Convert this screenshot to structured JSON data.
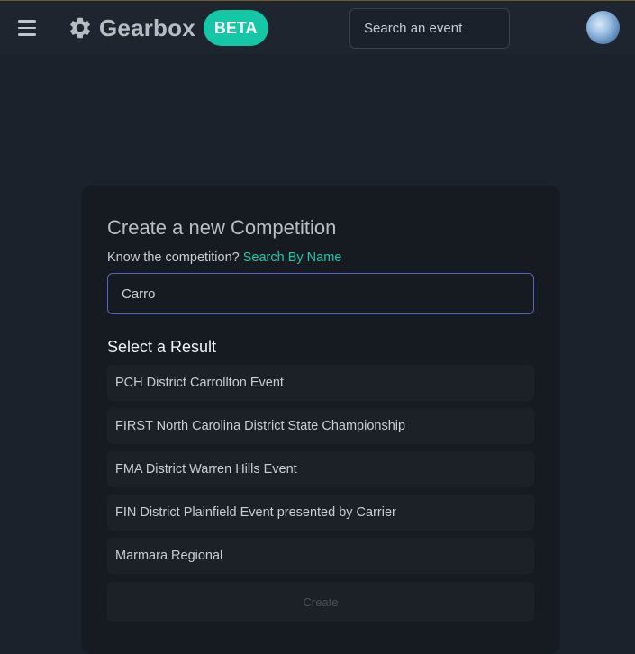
{
  "header": {
    "brand_name": "Gearbox",
    "badge": "BETA",
    "search_placeholder": "Search an event",
    "menu_icon": "hamburger-menu-icon",
    "logo_icon": "gear-icon"
  },
  "colors": {
    "accent": "#14c7a7",
    "link": "#1fc8a9",
    "input_focus_border": "#5a5fc4",
    "background": "#1b222b",
    "card": "#161b21"
  },
  "form": {
    "title": "Create a new Competition",
    "prompt": "Know the competition?",
    "prompt_link": "Search By Name",
    "input_value": "Carro",
    "results_title": "Select a Result",
    "results": [
      "PCH District Carrollton Event",
      "FIRST North Carolina District State Championship",
      "FMA District Warren Hills Event",
      "FIN District Plainfield Event presented by Carrier",
      "Marmara Regional"
    ],
    "create_label": "Create"
  }
}
